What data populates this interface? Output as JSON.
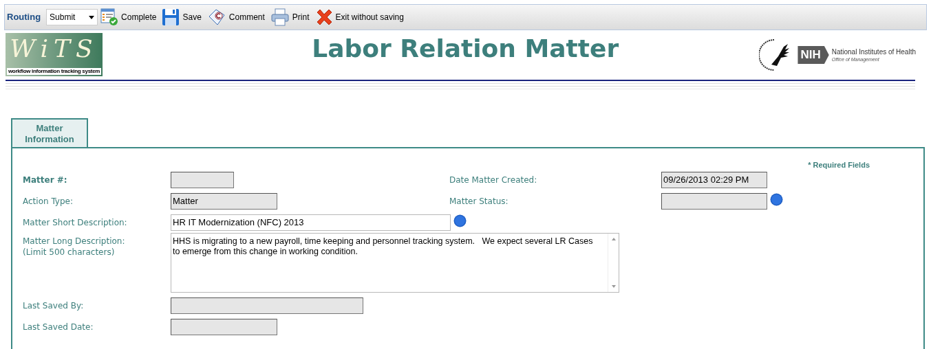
{
  "toolbar": {
    "routing_label": "Routing",
    "routing_select": "Submit",
    "buttons": [
      {
        "kind": "complete",
        "label": "Complete"
      },
      {
        "kind": "save",
        "label": "Save"
      },
      {
        "kind": "comment",
        "label": "Comment"
      },
      {
        "kind": "print",
        "label": "Print"
      },
      {
        "kind": "exit",
        "label": "Exit without saving"
      }
    ]
  },
  "header": {
    "logo_text": "WiTS",
    "logo_caption": "workflow information tracking system",
    "title": "Labor Relation Matter",
    "nih_badge": "NIH",
    "nih_name": "National Institutes of Health",
    "nih_office": "Office of Management"
  },
  "tabs": [
    {
      "label": "Matter Information",
      "selected": true
    }
  ],
  "form": {
    "required_note": "* Required Fields",
    "left_fields": [
      {
        "kind": "input",
        "label": "Matter #:",
        "required": true,
        "disabled": true,
        "help": false
      },
      {
        "kind": "input",
        "label": "Action Type:",
        "required": false,
        "value": "Matter",
        "disabled": true,
        "help": false
      },
      {
        "kind": "input",
        "label": "Matter Short Description:",
        "required": false,
        "value": "HR IT Modernization (NFC) 2013",
        "disabled": false,
        "help": true
      },
      {
        "kind": "textarea",
        "label": "Matter Long Description:",
        "note": "(Limit 500 characters)",
        "required": false,
        "value": "HHS is migrating to a new payroll, time keeping and personnel tracking system.   We expect several LR Cases to emerge from this change in working condition.",
        "disabled": false,
        "help": false
      },
      {
        "kind": "input",
        "label": "Last Saved By:",
        "required": false,
        "disabled": true,
        "help": false
      },
      {
        "kind": "input",
        "label": "Last Saved Date:",
        "required": false,
        "disabled": true,
        "help": false
      }
    ],
    "right_fields": [
      {
        "kind": "input",
        "label": "Date Matter Created:",
        "required": false,
        "value": "09/26/2013 02:29 PM",
        "disabled": true,
        "help": false
      },
      {
        "kind": "input",
        "label": "Matter Status:",
        "required": false,
        "disabled": true,
        "help": true
      }
    ]
  }
}
